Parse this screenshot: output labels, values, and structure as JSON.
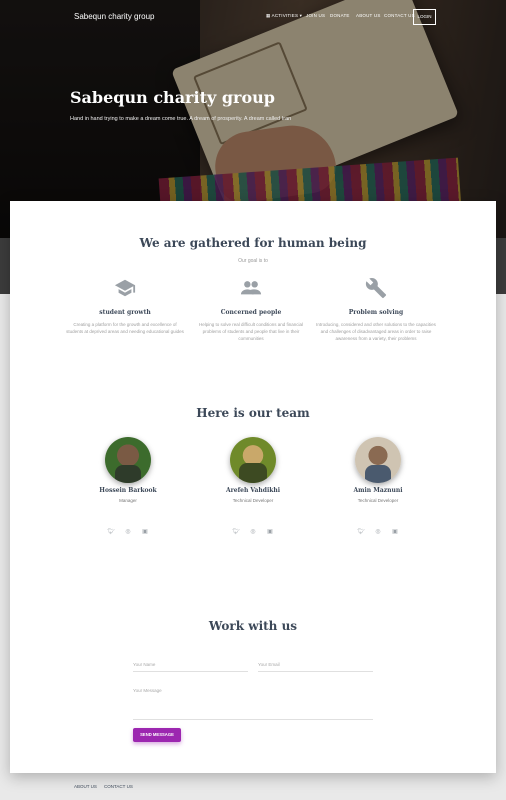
{
  "nav": {
    "brand": "Sabequn charity group",
    "items": [
      "ACTIVITIES",
      "JOIN US",
      "DONATE",
      "ABOUT US",
      "CONTACT US"
    ],
    "login": "LOGIN"
  },
  "hero": {
    "title": "Sabequn charity group",
    "subtitle": "Hand in hand trying to make a dream come true. A dream of prosperity. A dream called Iran"
  },
  "about": {
    "title": "We are gathered for human being",
    "subtitle": "Our goal is to",
    "features": [
      {
        "icon": "graduation-cap-icon",
        "title": "student growth",
        "desc": "Creating a platform for the growth and excellence of students at deprived areas and needing educational guides"
      },
      {
        "icon": "people-icon",
        "title": "Concerned people",
        "desc": "Helping to solve real difficult conditions and financial problems of students and people that live in their communities"
      },
      {
        "icon": "wrench-icon",
        "title": "Problem solving",
        "desc": "Introducing, considered and other solutions to the capacities and challenges of disadvantaged areas in order to raise awareness from a variety, their problems"
      }
    ]
  },
  "team": {
    "title": "Here is our team",
    "members": [
      {
        "name": "Hossein Barkook",
        "role": "Manager",
        "avatar": "avatar-hossein"
      },
      {
        "name": "Arefeh Vahdikhi",
        "role": "Technical Developer",
        "avatar": "avatar-arefeh"
      },
      {
        "name": "Amin Maznuni",
        "role": "Technical Developer",
        "avatar": "avatar-amin"
      }
    ]
  },
  "contact": {
    "title": "Work with us",
    "name_placeholder": "Your Name",
    "email_placeholder": "Your Email",
    "message_placeholder": "Your Message",
    "send": "SEND MESSAGE"
  },
  "footer": {
    "links": [
      "ABOUT US",
      "CONTACT US"
    ]
  },
  "colors": {
    "accent": "#9c27b0",
    "heading": "#3c4858"
  }
}
